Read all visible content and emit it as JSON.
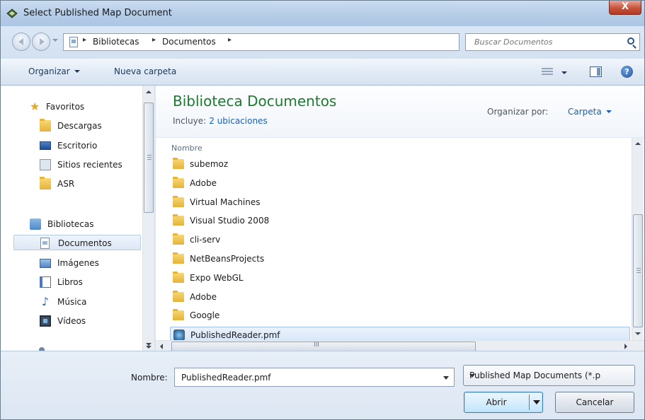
{
  "window": {
    "title": "Select Published Map Document",
    "close_label": "X"
  },
  "address": {
    "crumbs": [
      "Bibliotecas",
      "Documentos"
    ],
    "separator": "▸",
    "search_placeholder": "Buscar Documentos"
  },
  "toolbar": {
    "organize": "Organizar",
    "new_folder": "Nueva carpeta",
    "help": "?"
  },
  "sidebar": {
    "favorites": {
      "title": "Favoritos",
      "items": [
        "Descargas",
        "Escritorio",
        "Sitios recientes",
        "ASR"
      ]
    },
    "libraries": {
      "title": "Bibliotecas",
      "items": [
        "Documentos",
        "Imágenes",
        "Libros",
        "Música",
        "Vídeos"
      ]
    },
    "selected": "Documentos"
  },
  "library": {
    "title": "Biblioteca Documentos",
    "includes_label": "Incluye:",
    "includes_link": "2 ubicaciones",
    "arrange_label": "Organizar por:",
    "arrange_value": "Carpeta"
  },
  "file_list": {
    "column_header": "Nombre",
    "items": [
      {
        "name": "subemoz",
        "type": "folder"
      },
      {
        "name": "Adobe",
        "type": "folder"
      },
      {
        "name": "Virtual Machines",
        "type": "folder"
      },
      {
        "name": "Visual Studio 2008",
        "type": "folder"
      },
      {
        "name": "cli-serv",
        "type": "folder"
      },
      {
        "name": "NetBeansProjects",
        "type": "folder"
      },
      {
        "name": "Expo WebGL",
        "type": "folder"
      },
      {
        "name": "Adobe",
        "type": "folder"
      },
      {
        "name": "Google",
        "type": "folder"
      },
      {
        "name": "PublishedReader.pmf",
        "type": "pmf-file",
        "selected": true
      }
    ]
  },
  "hscroll": {
    "grip": "III"
  },
  "bottom": {
    "filename_label": "Nombre:",
    "filename_value": "PublishedReader.pmf",
    "filter_value": "Published Map Documents (*.p",
    "open_label": "Abrir",
    "cancel_label": "Cancelar"
  },
  "colors": {
    "library_title": "#1e7a2f",
    "link_blue": "#1b5fb5",
    "selection": "#d6e6f8"
  }
}
